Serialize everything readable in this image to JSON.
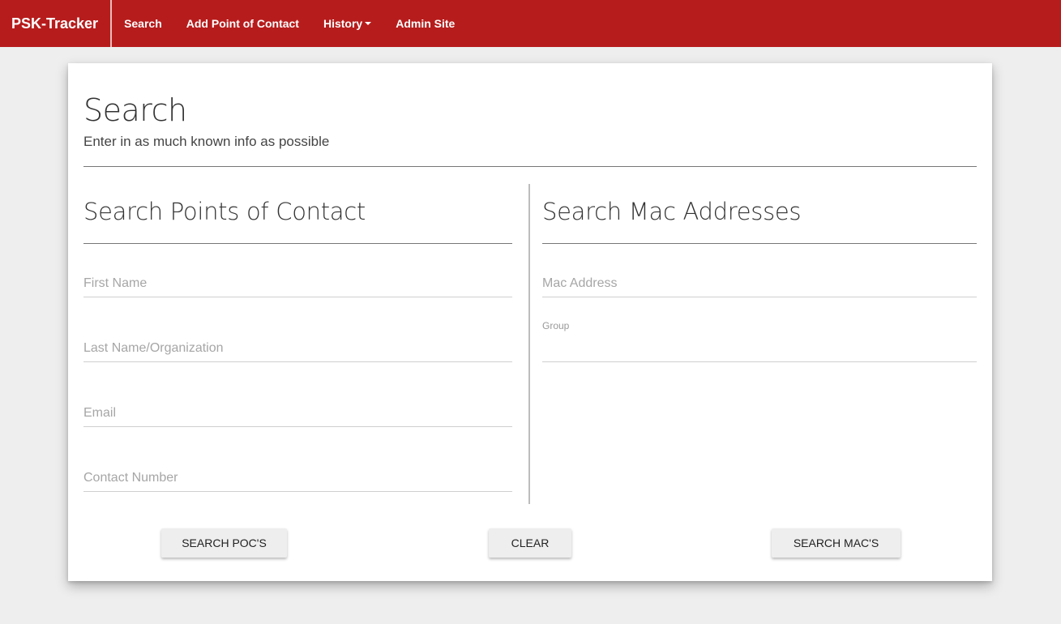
{
  "navbar": {
    "brand": "PSK-Tracker",
    "items": [
      {
        "label": "Search"
      },
      {
        "label": "Add Point of Contact"
      },
      {
        "label": "History"
      },
      {
        "label": "Admin Site"
      }
    ]
  },
  "page": {
    "title": "Search",
    "subtitle": "Enter in as much known info as possible"
  },
  "poc_section": {
    "title": "Search Points of Contact",
    "fields": {
      "first_name": {
        "placeholder": "First Name",
        "value": ""
      },
      "last_name": {
        "placeholder": "Last Name/Organization",
        "value": ""
      },
      "email": {
        "placeholder": "Email",
        "value": ""
      },
      "contact_number": {
        "placeholder": "Contact Number",
        "value": ""
      }
    }
  },
  "mac_section": {
    "title": "Search Mac Addresses",
    "fields": {
      "mac_address": {
        "placeholder": "Mac Address",
        "value": ""
      },
      "group": {
        "label": "Group",
        "value": ""
      }
    }
  },
  "buttons": {
    "search_pocs": "SEARCH POC'S",
    "clear": "CLEAR",
    "search_macs": "SEARCH MAC'S"
  },
  "colors": {
    "navbar": "#b71c1c",
    "page_background": "#eeeeee",
    "button_background": "#eeeeee"
  }
}
